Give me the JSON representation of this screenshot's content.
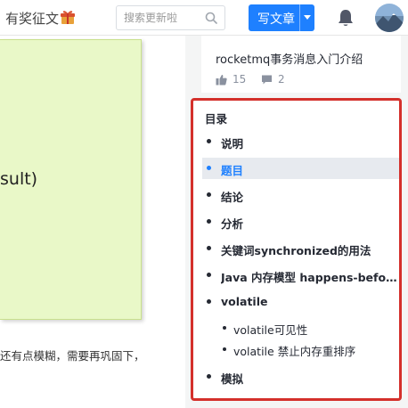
{
  "header": {
    "promo_text": "有奖征文",
    "search": {
      "placeholder": "搜索更新啦"
    },
    "write_button": "写文章"
  },
  "article": {
    "code_fragment": "sult)",
    "paragraph_fragment": "还有点模糊，需要再巩固下，"
  },
  "related": {
    "title": "rocketmq事务消息入门介绍",
    "likes": "15",
    "comments": "2"
  },
  "toc": {
    "title": "目录",
    "items": [
      {
        "label": "说明",
        "level": 1,
        "active": false
      },
      {
        "label": "题目",
        "level": 1,
        "active": true
      },
      {
        "label": "结论",
        "level": 1,
        "active": false
      },
      {
        "label": "分析",
        "level": 1,
        "active": false
      },
      {
        "label": "关键词synchronized的用法",
        "level": 1,
        "active": false
      },
      {
        "label": "Java 内存模型 happens-before...",
        "level": 1,
        "active": false
      },
      {
        "label": "volatile",
        "level": 1,
        "active": false
      },
      {
        "label": "volatile可见性",
        "level": 2,
        "active": false
      },
      {
        "label": "volatile 禁止内存重排序",
        "level": 2,
        "active": false
      },
      {
        "label": "模拟",
        "level": 1,
        "active": false
      }
    ]
  },
  "colors": {
    "accent": "#1e80ff",
    "highlight_border": "#d4302b",
    "code_bg": "#e9f8c8"
  }
}
